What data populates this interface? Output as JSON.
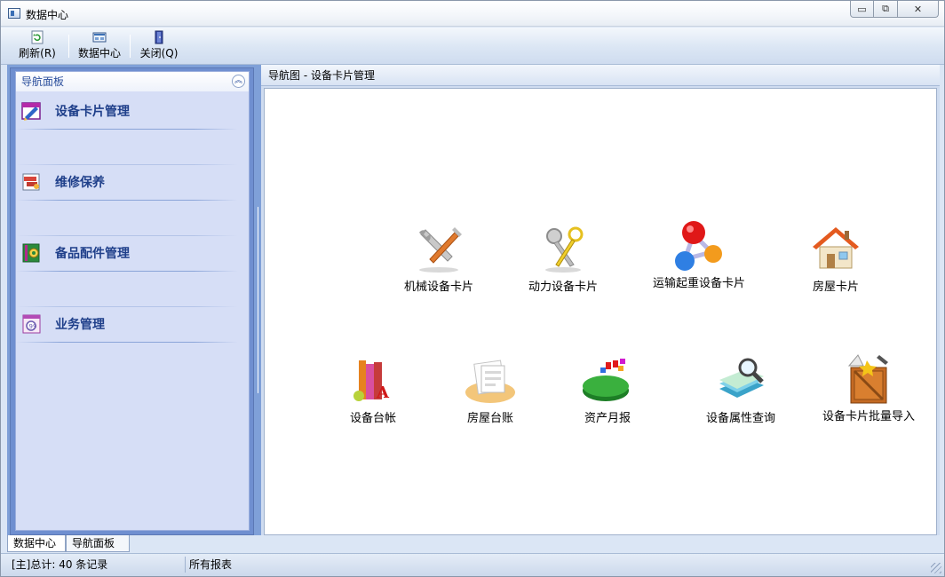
{
  "window": {
    "title": "数据中心",
    "controls": {
      "minimize": "▭",
      "maximize": "⧉",
      "close": "✕"
    }
  },
  "toolbar": {
    "buttons": [
      {
        "label": "刷新(R)",
        "icon": "refresh-icon"
      },
      {
        "label": "数据中心",
        "icon": "data-center-icon"
      },
      {
        "label": "关闭(Q)",
        "icon": "door-exit-icon"
      }
    ]
  },
  "nav": {
    "header": "导航面板",
    "collapse_glyph": "︽",
    "groups": [
      {
        "label": "设备卡片管理",
        "icon": "pen-card-icon"
      },
      {
        "label": "维修保养",
        "icon": "repair-tools-icon"
      },
      {
        "label": "备品配件管理",
        "icon": "gear-book-icon"
      },
      {
        "label": "业务管理",
        "icon": "business-icon"
      }
    ]
  },
  "content": {
    "breadcrumb": "导航图 -  设备卡片管理",
    "tiles": [
      {
        "label": "机械设备卡片",
        "icon": "wrench-screwdriver-icon"
      },
      {
        "label": "动力设备卡片",
        "icon": "keys-icon"
      },
      {
        "label": "运输起重设备卡片",
        "icon": "molecule-icon"
      },
      {
        "label": "房屋卡片",
        "icon": "house-icon"
      },
      {
        "label": "设备台帐",
        "icon": "books-icon"
      },
      {
        "label": "房屋台账",
        "icon": "document-stack-icon"
      },
      {
        "label": "资产月报",
        "icon": "pie-chart-icon"
      },
      {
        "label": "设备属性查询",
        "icon": "magnifier-books-icon"
      },
      {
        "label": "设备卡片批量导入",
        "icon": "wooden-box-icon"
      }
    ]
  },
  "bottom_tabs": [
    {
      "label": "数据中心",
      "active": true
    },
    {
      "label": "导航面板",
      "active": false
    }
  ],
  "status": {
    "record_count": "[主]总计: 40 条记录",
    "report": "所有报表"
  },
  "colors": {
    "nav_bg": "#d6def6",
    "nav_border": "#6f8fd0",
    "nav_text": "#1f3f8a",
    "toolbar_bg": "#dbe6f4"
  }
}
